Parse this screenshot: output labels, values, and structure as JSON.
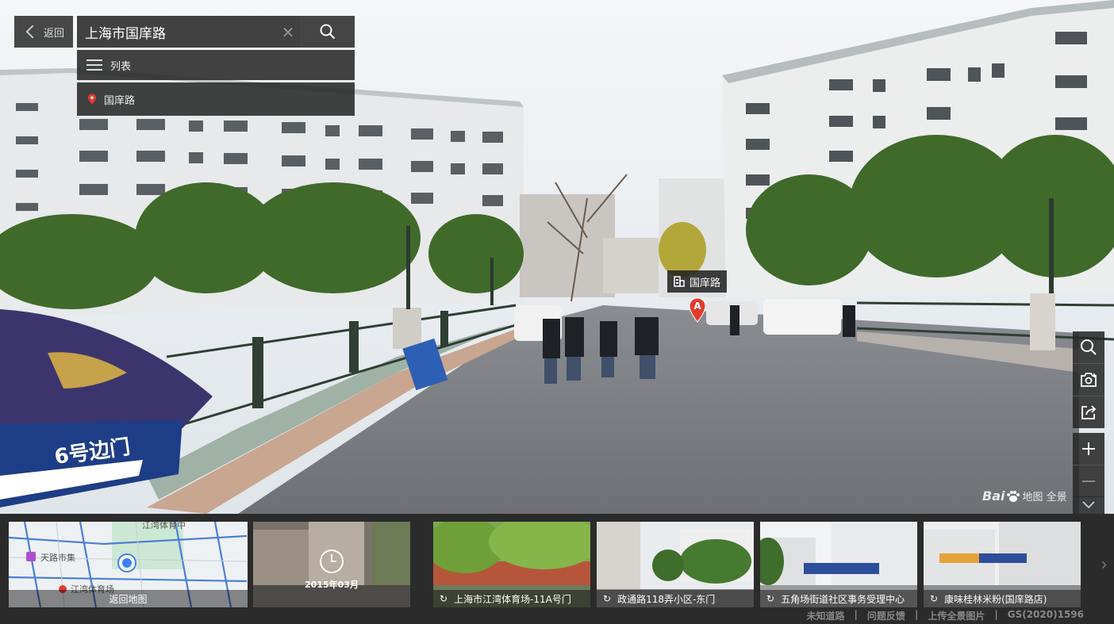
{
  "header": {
    "back_label": "返回",
    "search_value": "上海市国庠路",
    "list_label": "列表",
    "result_label": "国庠路"
  },
  "scene": {
    "poi_label": "国庠路",
    "marker_letter": "A",
    "sign_text_1": "6号边门"
  },
  "watermark": {
    "brand": "Bai",
    "text": "地图 全景"
  },
  "thumbnails": [
    {
      "caption": "返回地图",
      "map_labels": [
        "天路市集",
        "江湾体育场",
        "江湾体育中"
      ]
    },
    {
      "caption": "2015年03月"
    },
    {
      "caption": "上海市江湾体育场-11A号门"
    },
    {
      "caption": "政通路118弄小区-东门"
    },
    {
      "caption": "五角场街道社区事务受理中心"
    },
    {
      "caption": "康味桂林米粉(国庠路店)"
    }
  ],
  "footer": {
    "links": [
      "未知道路",
      "问题反馈",
      "上传全景图片",
      "GS(2020)1596"
    ]
  },
  "colors": {
    "accent": "#e23b2e",
    "panel": "#282828"
  }
}
